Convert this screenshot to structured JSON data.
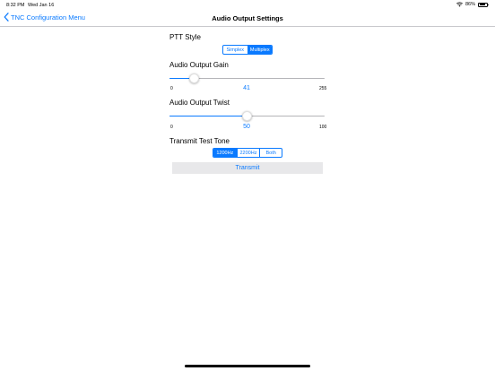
{
  "status": {
    "time": "8:32 PM",
    "date": "Wed Jan 16",
    "battery": "86%",
    "battery_level": 0.86
  },
  "nav": {
    "back_label": "TNC Configuration Menu",
    "title": "Audio Output Settings"
  },
  "ptt": {
    "title": "PTT Style",
    "options": [
      "Simplex",
      "Multiplex"
    ],
    "selected": 1
  },
  "gain": {
    "title": "Audio Output Gain",
    "min": "0",
    "max": "255",
    "value": "41",
    "min_value": 0,
    "max_value": 255,
    "current": 41
  },
  "twist": {
    "title": "Audio Output Twist",
    "min": "0",
    "max": "100",
    "value": "50",
    "min_value": 0,
    "max_value": 100,
    "current": 50
  },
  "tone": {
    "title": "Transmit Test Tone",
    "options": [
      "1200Hz",
      "2200Hz",
      "Both"
    ],
    "selected": 0
  },
  "transmit": {
    "label": "Transmit"
  },
  "colors": {
    "accent": "#0a7aff",
    "button_bg": "#e8e8ea"
  }
}
